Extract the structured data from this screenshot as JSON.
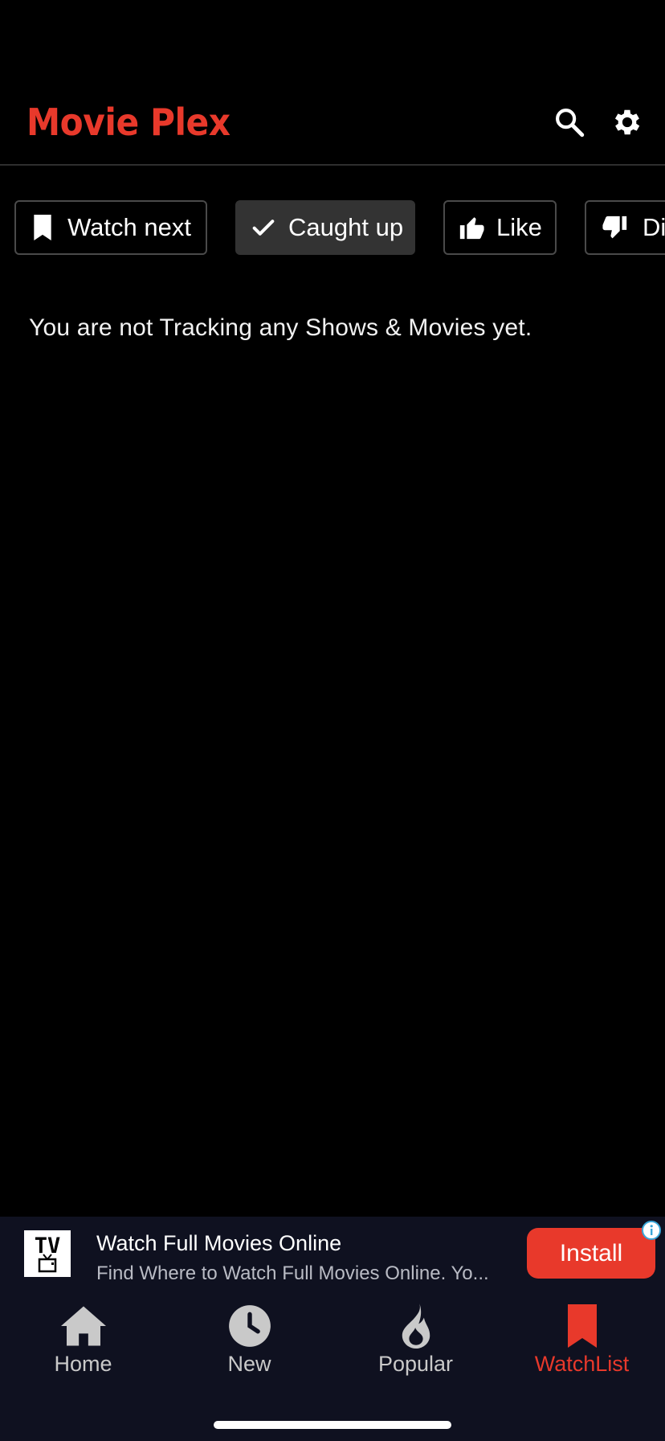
{
  "app": {
    "title": "Movie Plex"
  },
  "filters": [
    {
      "label": "Watch next",
      "icon": "bookmark-icon",
      "active": false
    },
    {
      "label": "Caught up",
      "icon": "check-icon",
      "active": true
    },
    {
      "label": "Like",
      "icon": "thumbs-up-icon",
      "active": false
    },
    {
      "label": "Dislike",
      "icon": "thumbs-down-icon",
      "active": false
    }
  ],
  "empty_state": "You are not Tracking any Shows & Movies yet.",
  "ad": {
    "logo_text": "TV",
    "title": "Watch Full Movies Online",
    "description": "Find Where to Watch Full Movies Online. Yo...",
    "install_label": "Install"
  },
  "nav": [
    {
      "label": "Home",
      "icon": "home-icon",
      "active": false
    },
    {
      "label": "New",
      "icon": "clock-icon",
      "active": false
    },
    {
      "label": "Popular",
      "icon": "flame-icon",
      "active": false
    },
    {
      "label": "WatchList",
      "icon": "bookmark-icon",
      "active": true
    }
  ],
  "colors": {
    "accent": "#e8392b",
    "background": "#000000",
    "bar": "#0f1120",
    "chip_active": "#333333"
  }
}
